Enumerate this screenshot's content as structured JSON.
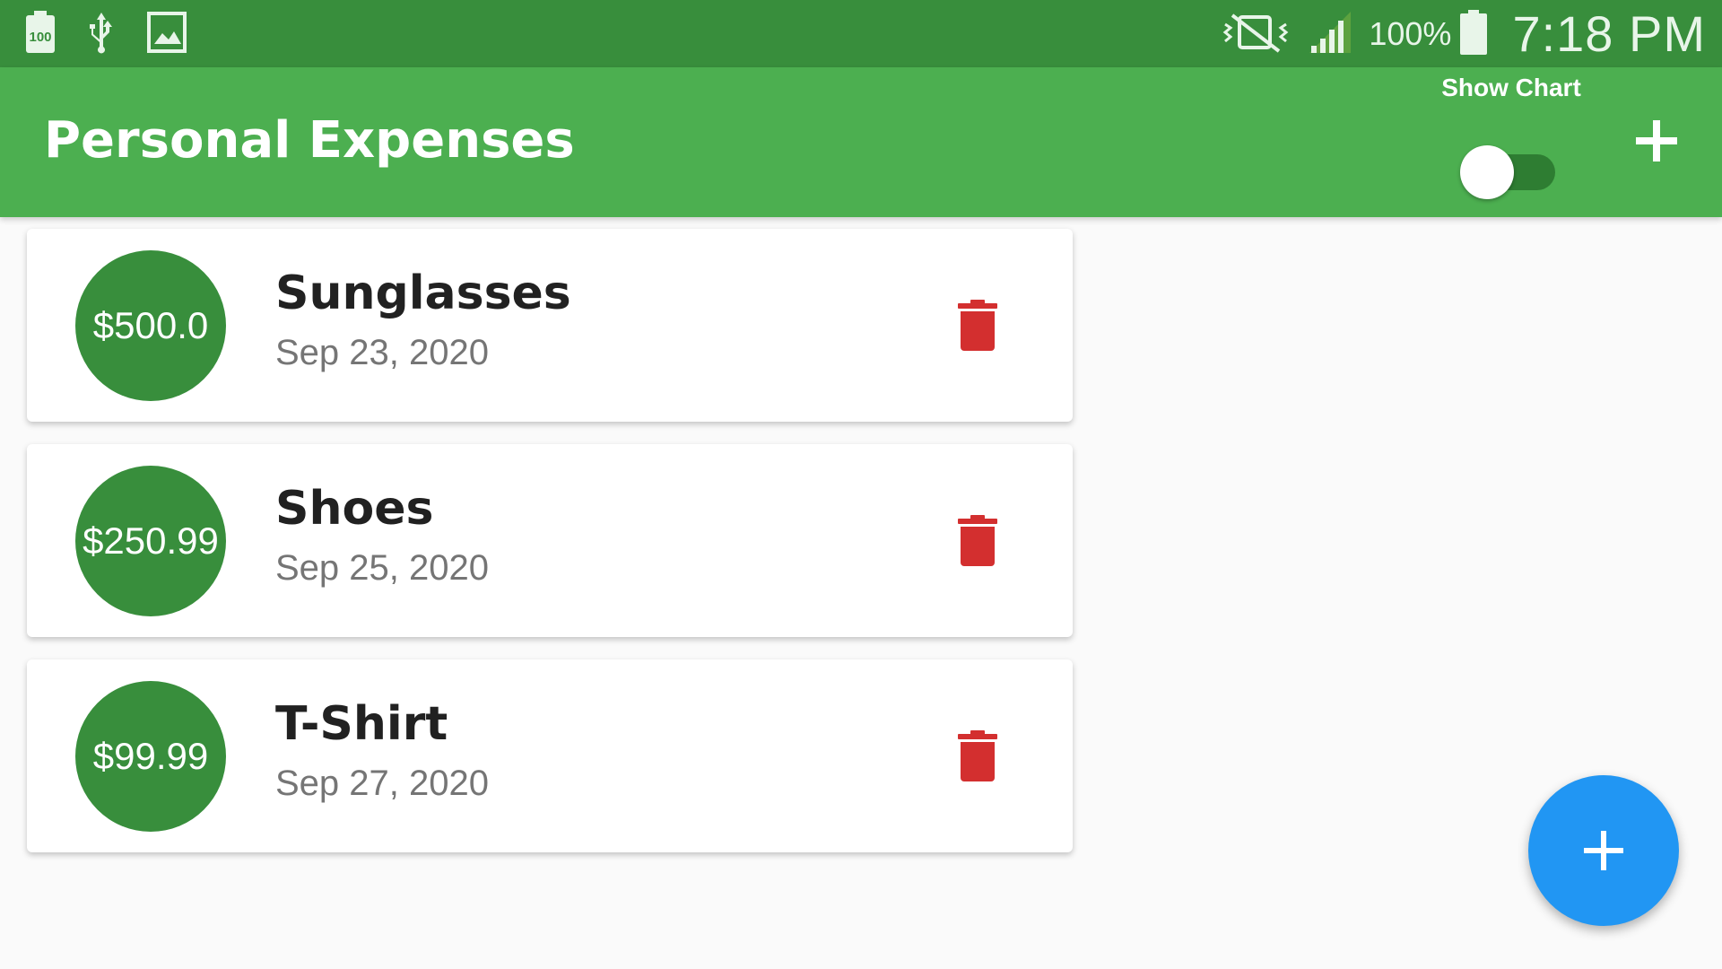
{
  "status_bar": {
    "icons_left": [
      "battery-100-notification-icon",
      "usb-icon",
      "image-icon"
    ],
    "icons_right": [
      "vibrate-off-icon",
      "signal-icon",
      "battery-icon"
    ],
    "battery_icon_label": "100",
    "battery_percent": "100%",
    "time": "7:18 PM"
  },
  "app_bar": {
    "title": "Personal Expenses",
    "toggle_label": "Show Chart",
    "toggle_on": false,
    "add_icon": "plus-icon"
  },
  "transactions": [
    {
      "amount": "$500.0",
      "title": "Sunglasses",
      "date": "Sep 23, 2020",
      "delete_icon": "trash-icon"
    },
    {
      "amount": "$250.99",
      "title": "Shoes",
      "date": "Sep 25, 2020",
      "delete_icon": "trash-icon"
    },
    {
      "amount": "$99.99",
      "title": "T-Shirt",
      "date": "Sep 27, 2020",
      "delete_icon": "trash-icon"
    }
  ],
  "fab": {
    "icon": "plus-icon"
  },
  "colors": {
    "status_bar": "#388e3c",
    "app_bar": "#4caf50",
    "amount_circle": "#388e3c",
    "delete": "#d32f2f",
    "fab": "#2196f3",
    "background": "#fafafa"
  }
}
